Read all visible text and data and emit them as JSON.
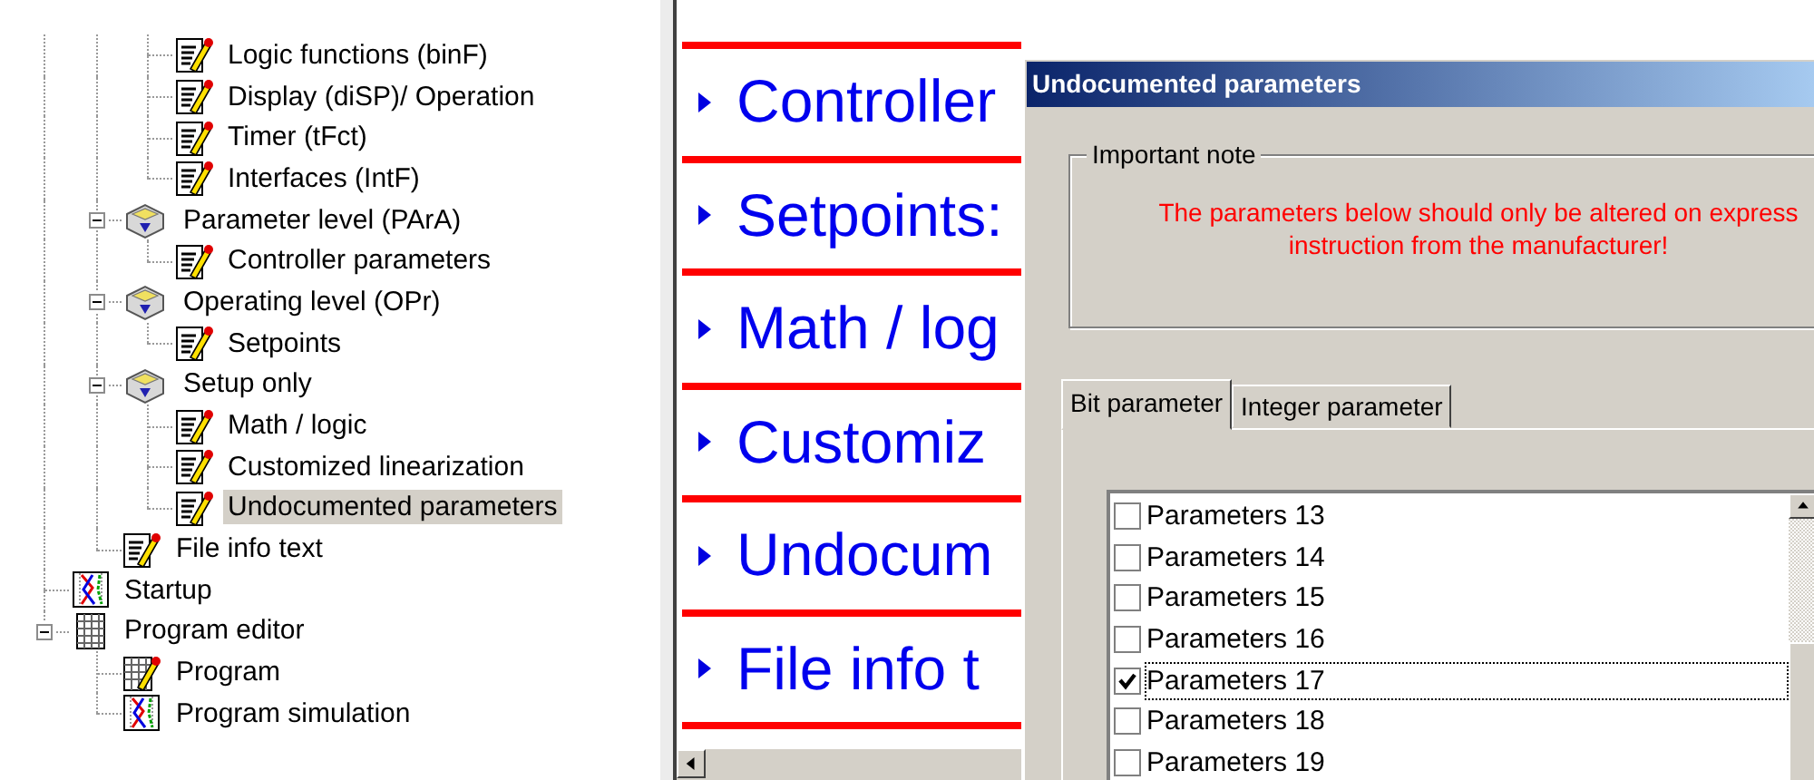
{
  "tree": {
    "items": [
      {
        "children": [
          {
            "children": [
              {
                "label": "Logic functions (binF)",
                "selected": false,
                "kind": "document"
              },
              {
                "label": "Display (diSP)/ Operation",
                "selected": false,
                "kind": "document"
              },
              {
                "label": "Timer (tFct)",
                "selected": false,
                "kind": "document"
              },
              {
                "label": "Interfaces (IntF)",
                "selected": false,
                "kind": "document"
              }
            ]
          },
          {
            "label": "Parameter level (PArA)",
            "expanded": true,
            "selected": false,
            "kind": "level",
            "children": [
              {
                "label": "Controller parameters",
                "selected": false,
                "kind": "document"
              }
            ]
          },
          {
            "label": "Operating level (OPr)",
            "expanded": true,
            "selected": false,
            "kind": "level",
            "children": [
              {
                "label": "Setpoints",
                "selected": false,
                "kind": "document"
              }
            ]
          },
          {
            "label": "Setup only",
            "expanded": true,
            "selected": false,
            "kind": "level",
            "children": [
              {
                "label": "Math / logic",
                "selected": false,
                "kind": "document"
              },
              {
                "label": "Customized linearization",
                "selected": false,
                "kind": "document"
              },
              {
                "label": "Undocumented parameters",
                "selected": true,
                "kind": "document"
              }
            ]
          },
          {
            "label": "File info text",
            "selected": false,
            "kind": "document"
          }
        ]
      },
      {
        "label": "Startup",
        "selected": false,
        "kind": "chart"
      },
      {
        "label": "Program editor",
        "expanded": true,
        "selected": false,
        "kind": "grid",
        "children": [
          {
            "label": "Program",
            "selected": false,
            "kind": "grid-edit"
          },
          {
            "label": "Program simulation",
            "selected": false,
            "kind": "chart"
          }
        ]
      }
    ]
  },
  "sections": [
    "Controller",
    "Setpoints:",
    "Math / log",
    "Customiz",
    "Undocum",
    "File info t"
  ],
  "dialog": {
    "title": "Undocumented parameters",
    "note": {
      "heading": "Important note",
      "text": "The parameters below should only be altered on express instruction from the manufacturer!"
    },
    "tabs": [
      {
        "label": "Bit parameter",
        "selected": true
      },
      {
        "label": "Integer parameter",
        "selected": false
      }
    ],
    "parameters": [
      {
        "label": "Parameters 13",
        "checked": false,
        "focused": false
      },
      {
        "label": "Parameters 14",
        "checked": false,
        "focused": false
      },
      {
        "label": "Parameters 15",
        "checked": false,
        "focused": false
      },
      {
        "label": "Parameters 16",
        "checked": false,
        "focused": false
      },
      {
        "label": "Parameters 17",
        "checked": true,
        "focused": true
      },
      {
        "label": "Parameters 18",
        "checked": false,
        "focused": false
      },
      {
        "label": "Parameters 19",
        "checked": false,
        "focused": false
      }
    ]
  }
}
